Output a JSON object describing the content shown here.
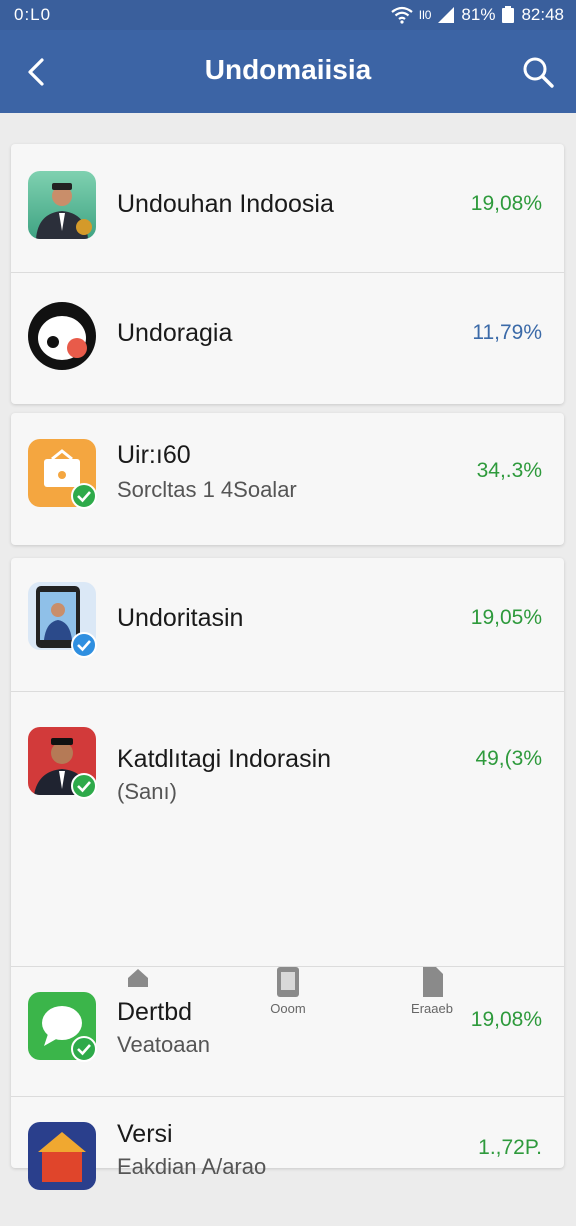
{
  "status_bar": {
    "left": "0:L0",
    "signal_text": "Il0",
    "battery": "81%",
    "time": "82:48"
  },
  "app_bar": {
    "title": "Undomaiisia"
  },
  "items": [
    {
      "name": "Undouhan Indoosia",
      "percent": "19,08%",
      "percent_color": "#2e9a3c"
    },
    {
      "name": "Undoragia",
      "percent": "11,79%",
      "percent_color": "#3b6aa8"
    },
    {
      "name": "Uir:ı60",
      "subtitle": "Sorcltas  1 4Soalar",
      "percent": "34,.3%",
      "percent_color": "#2e9a3c"
    },
    {
      "name": "Undoritasin",
      "percent": "19,05%",
      "percent_color": "#2e9a3c"
    },
    {
      "name": "Katdlıtagi Indorasin",
      "subtitle": "(Sanı)",
      "percent": "49,(3%",
      "percent_color": "#2e9a3c"
    },
    {
      "name": "Dertbd",
      "subtitle": "Veatoaan",
      "percent": "19,08%",
      "percent_color": "#2e9a3c"
    },
    {
      "name": "Versi",
      "subtitle": "Eakdian A/arao",
      "percent": "1.,72P.",
      "percent_color": "#2e9a3c"
    }
  ],
  "bottom_nav": {
    "center_label": "Ooom",
    "right_label": "Eraaeb"
  }
}
